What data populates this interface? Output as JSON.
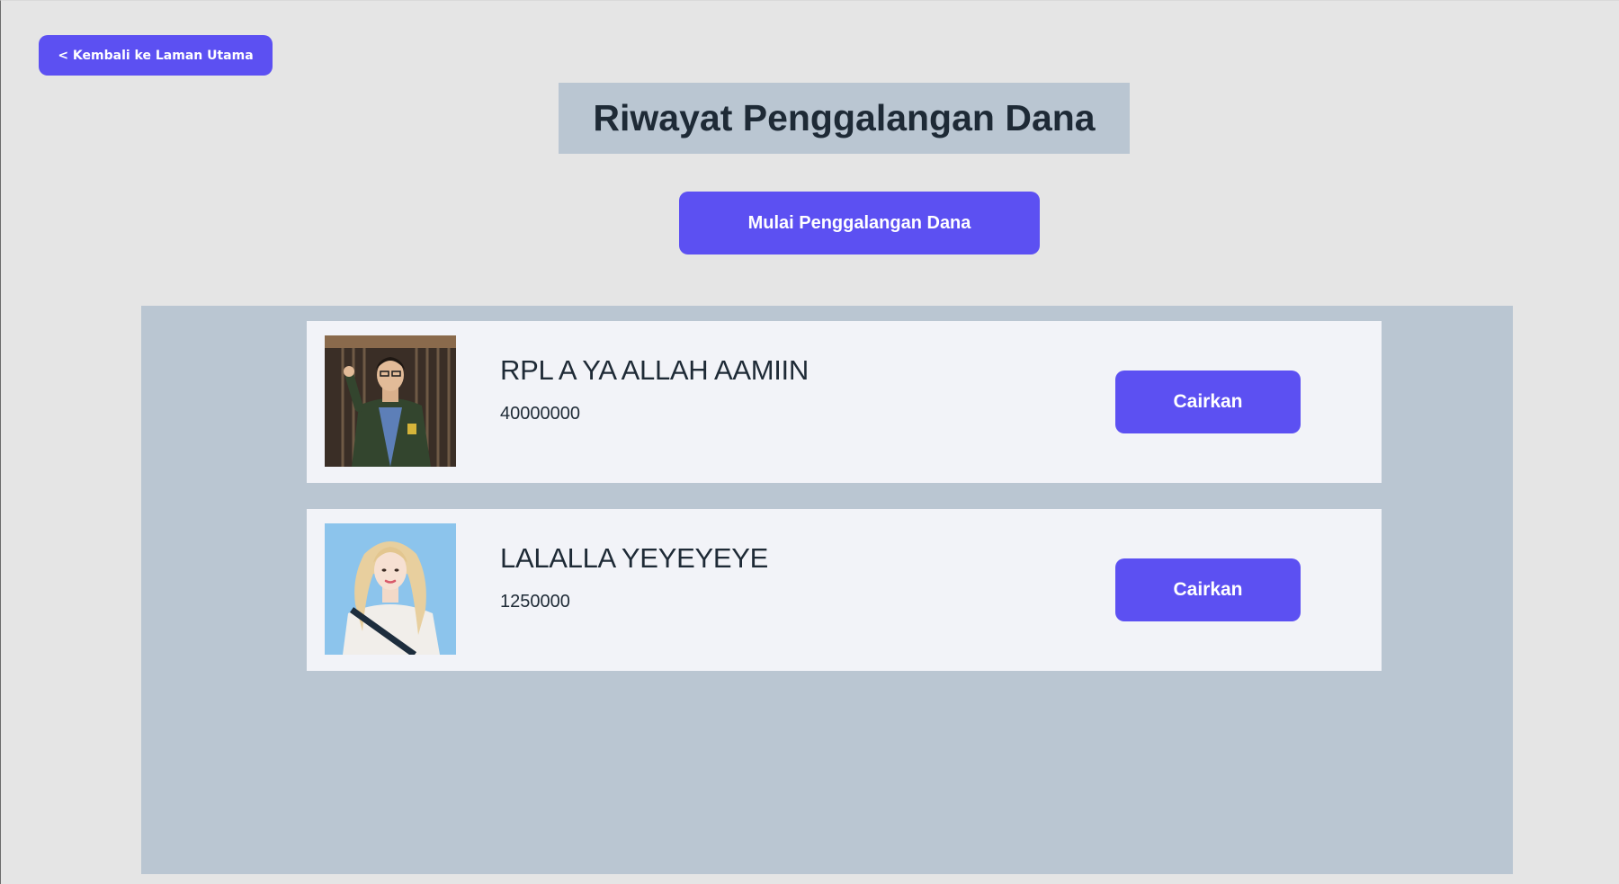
{
  "nav": {
    "back_label": "< Kembali ke Laman Utama"
  },
  "header": {
    "title": "Riwayat Penggalangan Dana"
  },
  "actions": {
    "start_label": "Mulai Penggalangan Dana"
  },
  "campaigns": [
    {
      "title": "RPL A YA ALLAH AAMIIN",
      "amount": "40000000",
      "button_label": "Cairkan"
    },
    {
      "title": "LALALLA YEYEYEYE",
      "amount": "1250000",
      "button_label": "Cairkan"
    }
  ],
  "colors": {
    "accent": "#5c50f2",
    "background": "#e5e5e5",
    "panel": "#bac6d2",
    "card": "#f2f3f8",
    "text": "#1e2a36"
  }
}
